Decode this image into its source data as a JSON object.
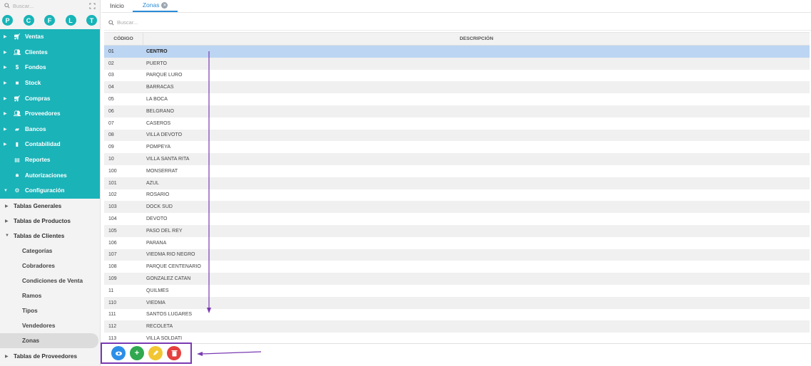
{
  "sidebar": {
    "search_placeholder": "Buscar...",
    "circles": [
      "P",
      "C",
      "F",
      "L",
      "T"
    ],
    "menu": [
      {
        "label": "Ventas",
        "icon": "cart-icon",
        "caret": true
      },
      {
        "label": "Clientes",
        "icon": "people-icon",
        "caret": true
      },
      {
        "label": "Fondos",
        "icon": "dollar-icon",
        "caret": true
      },
      {
        "label": "Stock",
        "icon": "box-icon",
        "caret": true
      },
      {
        "label": "Compras",
        "icon": "cart-icon",
        "caret": true
      },
      {
        "label": "Proveedores",
        "icon": "people-icon",
        "caret": true
      },
      {
        "label": "Bancos",
        "icon": "briefcase-icon",
        "caret": true
      },
      {
        "label": "Contabilidad",
        "icon": "ledger-icon",
        "caret": true
      },
      {
        "label": "Reportes",
        "icon": "report-icon",
        "caret": false
      },
      {
        "label": "Autorizaciones",
        "icon": "lock-icon",
        "caret": false
      },
      {
        "label": "Configuración",
        "icon": "gears-icon",
        "caret": true
      }
    ],
    "sub": {
      "tablas_generales": "Tablas Generales",
      "tablas_productos": "Tablas de Productos",
      "tablas_clientes": "Tablas de Clientes",
      "categorias": "Categorías",
      "cobradores": "Cobradores",
      "condiciones": "Condiciones de Venta",
      "ramos": "Ramos",
      "tipos": "Tipos",
      "vendedores": "Vendedores",
      "zonas": "Zonas",
      "tablas_proveedores": "Tablas de Proveedores"
    }
  },
  "tabs": {
    "inicio": "Inicio",
    "zonas": "Zonas"
  },
  "search": {
    "placeholder": "Buscar..."
  },
  "table": {
    "col_codigo": "CÓDIGO",
    "col_descripcion": "DESCRIPCIÓN",
    "rows": [
      [
        "01",
        "CENTRO"
      ],
      [
        "02",
        "PUERTO"
      ],
      [
        "03",
        "PARQUE LURO"
      ],
      [
        "04",
        "BARRACAS"
      ],
      [
        "05",
        "LA BOCA"
      ],
      [
        "06",
        "BELGRANO"
      ],
      [
        "07",
        "CASEROS"
      ],
      [
        "08",
        "VILLA DEVOTO"
      ],
      [
        "09",
        "POMPEYA"
      ],
      [
        "10",
        "VILLA SANTA RITA"
      ],
      [
        "100",
        "MONSERRAT"
      ],
      [
        "101",
        "AZUL"
      ],
      [
        "102",
        "ROSARIO"
      ],
      [
        "103",
        "DOCK SUD"
      ],
      [
        "104",
        "DEVOTO"
      ],
      [
        "105",
        "PASO DEL REY"
      ],
      [
        "106",
        "PARANA"
      ],
      [
        "107",
        "VIEDMA RIO NEGRO"
      ],
      [
        "108",
        "PARQUE CENTENARIO"
      ],
      [
        "109",
        "GONZALEZ CATAN"
      ],
      [
        "11",
        "QUILMES"
      ],
      [
        "110",
        "VIEDMA"
      ],
      [
        "111",
        "SANTOS LUGARES"
      ],
      [
        "112",
        "RECOLETA"
      ],
      [
        "113",
        "VILLA SOLDATI"
      ]
    ]
  },
  "colors": {
    "sidebar_accent": "#1ab3b8",
    "tab_active": "#2a8bd6",
    "selected_row": "#bcd5f3",
    "view_button": "#2d8ee8",
    "add_button": "#2fa84f",
    "edit_button": "#f2c633",
    "delete_button": "#e4403f",
    "annotation": "#7a3ab2"
  }
}
